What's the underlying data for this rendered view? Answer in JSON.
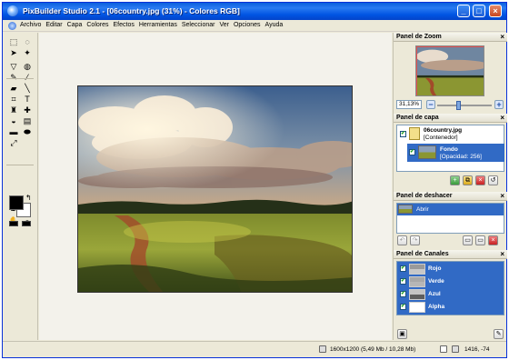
{
  "window": {
    "title": "PixBuilder Studio 2.1 - [06country.jpg (31%) - Colores RGB]",
    "controls": [
      "_",
      "□",
      "×"
    ]
  },
  "menu": {
    "items": [
      "Archivo",
      "Editar",
      "Capa",
      "Colores",
      "Efectos",
      "Herramientas",
      "Seleccionar",
      "Ver",
      "Opciones",
      "Ayuda"
    ]
  },
  "toolbox": {
    "tools": [
      {
        "name": "rect-select-icon",
        "glyph": "⬚"
      },
      {
        "name": "lasso-icon",
        "glyph": "◌"
      },
      {
        "name": "move-icon",
        "glyph": "➤"
      },
      {
        "name": "magic-wand-icon",
        "glyph": "✦"
      },
      {
        "name": "poly-lasso-icon",
        "glyph": "▽"
      },
      {
        "name": "magnetic-lasso-icon",
        "glyph": "◍"
      },
      {
        "name": "pencil-icon",
        "glyph": "✎"
      },
      {
        "name": "brush-icon",
        "glyph": "⁄"
      },
      {
        "name": "eraser-icon",
        "glyph": "▰"
      },
      {
        "name": "line-icon",
        "glyph": "╲"
      },
      {
        "name": "crop-icon",
        "glyph": "⌗"
      },
      {
        "name": "text-icon",
        "glyph": "T"
      },
      {
        "name": "clone-stamp-icon",
        "glyph": "♜"
      },
      {
        "name": "heal-icon",
        "glyph": "✚"
      },
      {
        "name": "bucket-icon",
        "glyph": "◒"
      },
      {
        "name": "gradient-icon",
        "glyph": "▤"
      },
      {
        "name": "rect-shape-icon",
        "glyph": "▬"
      },
      {
        "name": "ellipse-shape-icon",
        "glyph": "⬬"
      },
      {
        "name": "transform-icon",
        "glyph": "⤢"
      },
      {
        "name": "blank-icon",
        "glyph": ""
      },
      {
        "name": "eyedropper-icon",
        "glyph": "✒"
      },
      {
        "name": "measure-icon",
        "glyph": "✐"
      },
      {
        "name": "hand-icon",
        "glyph": "✋"
      },
      {
        "name": "zoom-icon",
        "glyph": "⌕"
      }
    ]
  },
  "zoom_panel": {
    "title": "Panel de Zoom",
    "close": "×",
    "percent": "31,13%",
    "minus": "−",
    "plus": "+",
    "slider_fraction": 0.38
  },
  "layers_panel": {
    "title": "Panel de capa",
    "close": "×",
    "container_name": "06country.jpg",
    "container_sub": "[Contenedor]",
    "layer_name": "Fondo",
    "layer_sub": "[Opacidad: 256]",
    "buttons": [
      "+",
      "⧉",
      "×",
      "↺"
    ]
  },
  "undo_panel": {
    "title": "Panel de deshacer",
    "close": "×",
    "items": [
      "Abrir"
    ],
    "buttons": [
      "↶",
      "↷",
      "▭",
      "▭",
      "×"
    ]
  },
  "channels_panel": {
    "title": "Panel de Canales",
    "close": "×",
    "channels": [
      "Rojo",
      "Verde",
      "Azul",
      "Alpha"
    ],
    "buttons": [
      "▣",
      "✎"
    ]
  },
  "status": {
    "size_text": "1600x1200  (5,49 Mb / 10,28 Mb)",
    "coords_text": "1416, -74"
  },
  "colors": {
    "titlebar": "#0054e3",
    "selection": "#316ac5",
    "panel_bg": "#ece9d8"
  }
}
